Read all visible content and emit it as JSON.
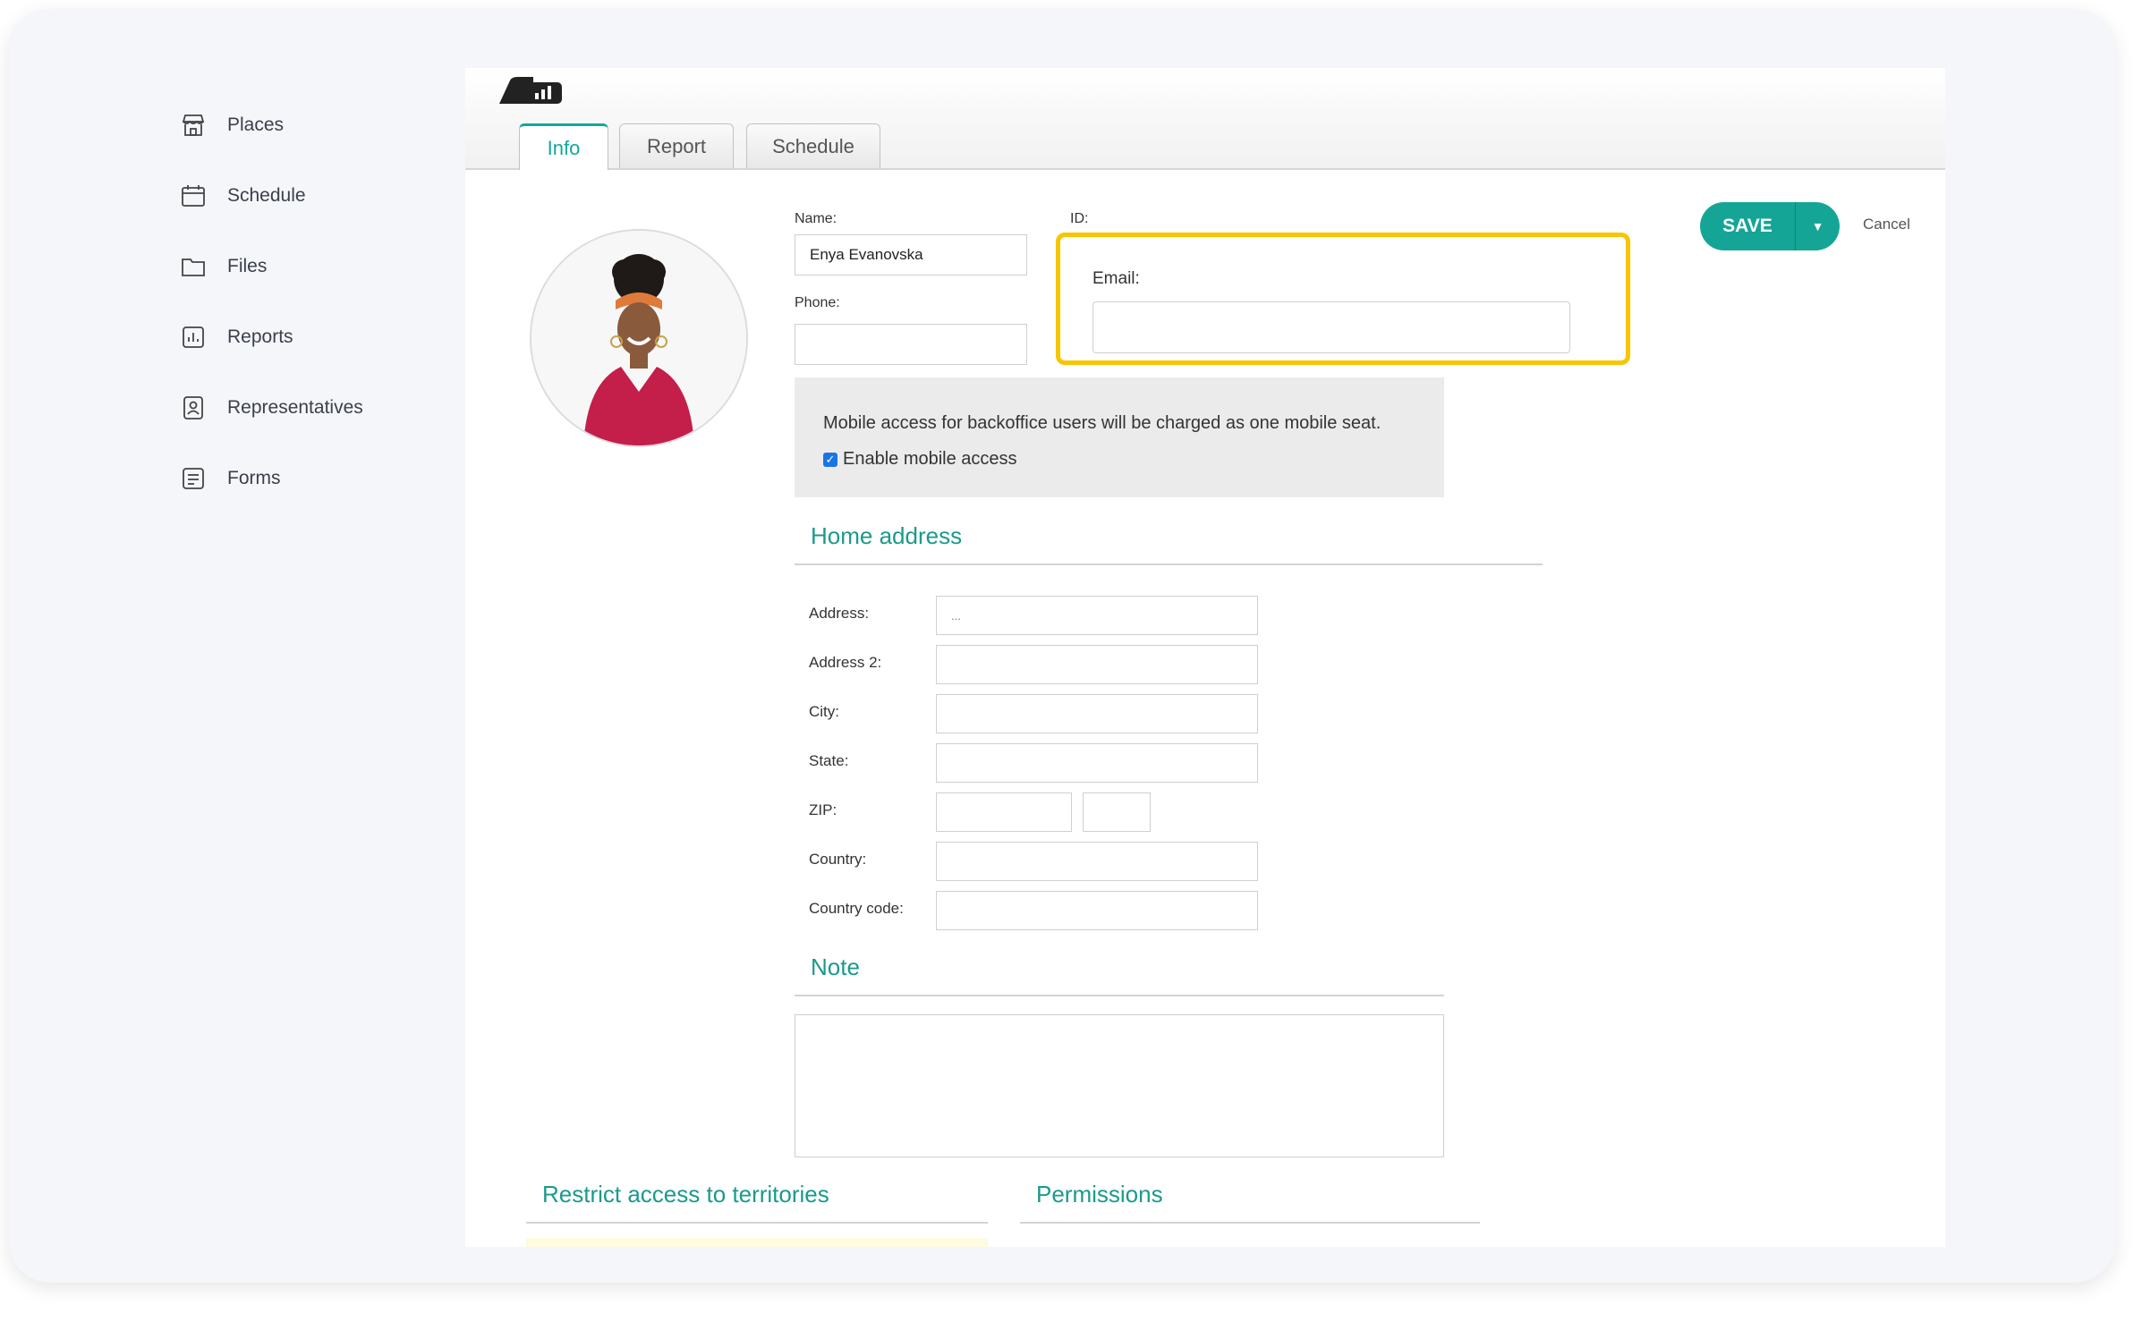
{
  "sidebar": {
    "items": [
      {
        "label": "Places",
        "icon": "store-icon"
      },
      {
        "label": "Schedule",
        "icon": "calendar-icon"
      },
      {
        "label": "Files",
        "icon": "folder-icon"
      },
      {
        "label": "Reports",
        "icon": "report-icon"
      },
      {
        "label": "Representatives",
        "icon": "user-badge-icon"
      },
      {
        "label": "Forms",
        "icon": "form-icon"
      }
    ]
  },
  "tabs": [
    {
      "label": "Info",
      "active": true
    },
    {
      "label": "Report",
      "active": false
    },
    {
      "label": "Schedule",
      "active": false
    }
  ],
  "form": {
    "name_label": "Name:",
    "name_value": "Enya Evanovska",
    "id_label": "ID:",
    "phone_label": "Phone:",
    "phone_value": "",
    "email_label": "Email:",
    "email_value": ""
  },
  "actions": {
    "save_label": "SAVE",
    "dropdown_icon": "caret-down-icon",
    "cancel_label": "Cancel"
  },
  "mobile": {
    "message": "Mobile access for backoffice users will be charged as one mobile seat.",
    "checkbox_label": "Enable mobile access",
    "checked": true
  },
  "home_address": {
    "title": "Home address",
    "address_label": "Address:",
    "address_value": "...",
    "address2_label": "Address 2:",
    "city_label": "City:",
    "state_label": "State:",
    "zip_label": "ZIP:",
    "country_label": "Country:",
    "country_code_label": "Country code:"
  },
  "note": {
    "title": "Note",
    "value": ""
  },
  "territories": {
    "title": "Restrict access to territories"
  },
  "permissions": {
    "title": "Permissions"
  },
  "colors": {
    "accent": "#15a596",
    "highlight": "#f7c600",
    "section_title": "#1a9a8c",
    "checkbox": "#1a73e8"
  }
}
